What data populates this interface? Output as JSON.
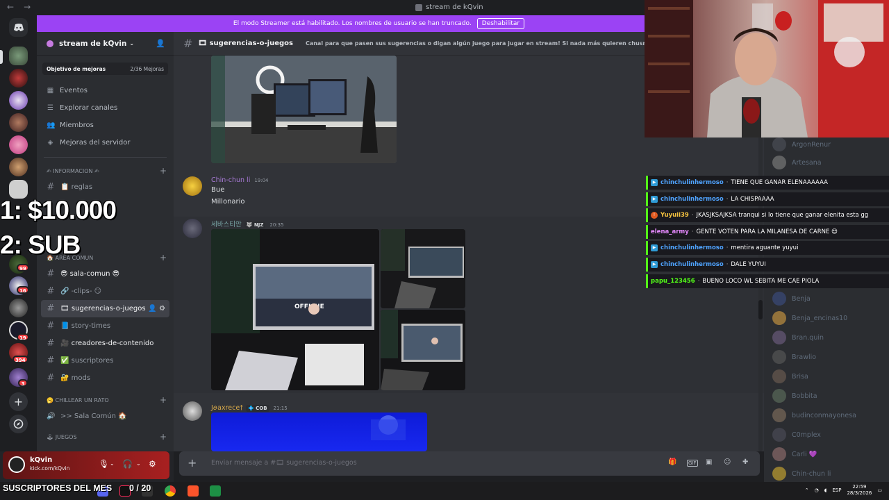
{
  "window": {
    "title": "stream de kQvin",
    "back": "←",
    "forward": "→"
  },
  "banner": {
    "message": "El modo Streamer está habilitado. Los nombres de usuario se han truncado.",
    "disable_label": "Deshabilitar"
  },
  "rail": {
    "badges": [
      "99",
      "16",
      "19",
      "394",
      "3"
    ]
  },
  "server": {
    "name": "stream de kQvin",
    "goal_label": "Objetivo de mejoras",
    "goal_progress": "2/36 Mejoras"
  },
  "menu": {
    "events": "Eventos",
    "browse": "Explorar canales",
    "members": "Miembros",
    "boosts": "Mejoras del servidor"
  },
  "categories": {
    "info": "✍ INFORMACION ✍",
    "area": "🏠 AREA COMUN",
    "chill": "🥱 CHILLEAR UN RATO",
    "games": "🕹 JUEGOS"
  },
  "channels": {
    "rules": "📋 reglas",
    "sala_comun": "😎 sala-comun 😎",
    "clips": "🔗 -clips- 😏",
    "sugerencias": "🎞 sugerencias-o-juegos",
    "story": "📘 story-times",
    "creadores": "🎥 creadores-de-contenido",
    "suscriptores": "✅ suscriptores",
    "mods": "🔐 mods",
    "voice_sala": ">> Sala Común 🏠"
  },
  "overlay": {
    "line1": "1: $10.000",
    "line2": "2: SUB"
  },
  "user": {
    "name": "kQvin",
    "status": "kick.com/kQvin"
  },
  "chat_header": {
    "name": "🎞 sugerencias-o-juegos",
    "topic": "Canal para que pasen sus sugerencias o digan algún juego para jugar en stream! Si nada más quieren chusmear y opinar puede"
  },
  "messages": [
    {
      "user": "Chin-chun li",
      "time": "19:04",
      "lines": [
        "Bue",
        "Millonario"
      ]
    },
    {
      "user": "세바스티안",
      "tag": "🐺 NJZ",
      "time": "20:35"
    },
    {
      "user": "Jꪮaxrece†",
      "tag": "💠 COB",
      "time": "21:15"
    }
  ],
  "image_text": {
    "offline": "OFFLINE"
  },
  "composer": {
    "placeholder": "Enviar mensaje a #🎞 sugerencias-o-juegos"
  },
  "member_list": [
    "ArgonRenur",
    "Artesana",
    "Benja",
    "Benja_encinas10",
    "Bran.quin",
    "Brawlio",
    "Brisa",
    "Bobbita",
    "budinconmayonesa",
    "C0mplex",
    "Carli 💜",
    "Chin-chun li"
  ],
  "stream_chat": [
    {
      "user": "chinchulinhermoso",
      "text": "TIENE QUE GANAR ELENAAAAAA",
      "color": "#4fa3ff"
    },
    {
      "user": "chinchulinhermoso",
      "text": "LA CHISPAAAA",
      "color": "#4fa3ff"
    },
    {
      "user": "Yuyuii39",
      "text": "JKASJKSAJKSA tranqui si lo tiene que ganar elenita esta gg",
      "color": "#f6c340"
    },
    {
      "user": "elena_army",
      "text": "GENTE VOTEN PARA LA MILANESA DE CARNE 😍",
      "color": "#e689ff"
    },
    {
      "user": "chinchulinhermoso",
      "text": "mentira aguante yuyui",
      "color": "#4fa3ff"
    },
    {
      "user": "chinchulinhermoso",
      "text": "DALE YUYUI",
      "color": "#4fa3ff"
    },
    {
      "user": "papu_123456",
      "text": "BUENO LOCO WL SEBITA ME CAE PIOLA",
      "color": "#53fc18"
    }
  ],
  "taskbar": {
    "subs_label": "SUSCRIPTORES DEL MES",
    "subs_count": "0 / 20",
    "lang": "ESP",
    "time": "22:59",
    "date": "28/3/2026"
  },
  "colors": {
    "accent": "#9b43f4",
    "kick_green": "#53fc18",
    "badge_red": "#f23f43"
  }
}
